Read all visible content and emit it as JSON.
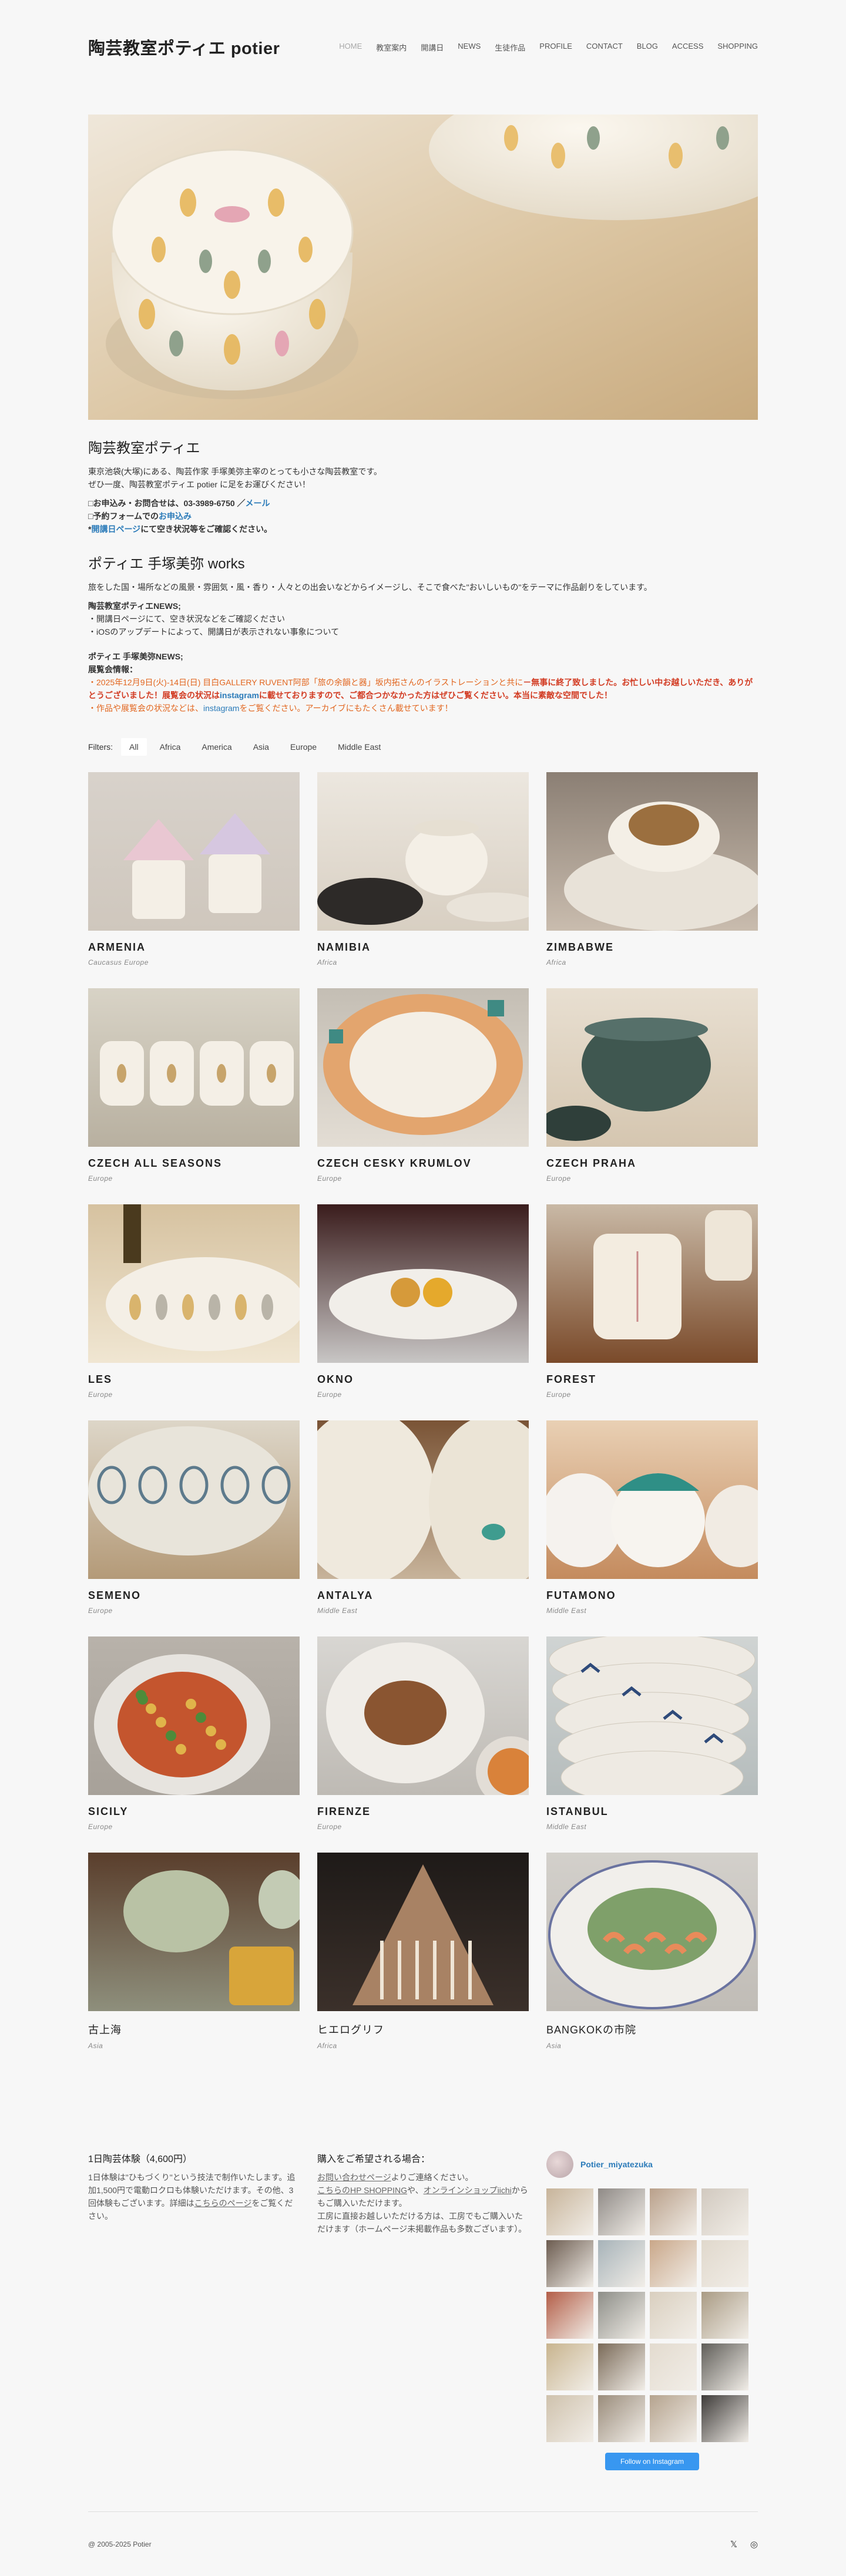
{
  "site": {
    "logo": "陶芸教室ポティエ potier"
  },
  "nav": [
    {
      "label": "HOME",
      "active": true
    },
    {
      "label": "教室案内"
    },
    {
      "label": "開講日"
    },
    {
      "label": "NEWS"
    },
    {
      "label": "生徒作品"
    },
    {
      "label": "PROFILE"
    },
    {
      "label": "CONTACT"
    },
    {
      "label": "BLOG"
    },
    {
      "label": "ACCESS"
    },
    {
      "label": "SHOPPING"
    }
  ],
  "intro": {
    "title": "陶芸教室ポティエ",
    "line1": "東京池袋(大塚)にある、陶芸作家 手塚美弥主宰のとっても小さな陶芸教室です。",
    "line2": "ぜひ一度、陶芸教室ポティエ potier に足をお運びください！",
    "contact_prefix": "□お申込み・お問合せは、",
    "contact_tel": "03-3989-6750",
    "contact_sep": " ／",
    "contact_mail": "メール",
    "form_prefix": "□予約フォームでの",
    "form_link": "お申込み",
    "calendar_prefix": "*",
    "calendar_link": "開講日ページ",
    "calendar_suffix": "にて空き状況等をご確認ください。",
    "works_title": "ポティエ 手塚美弥 works",
    "works_line": "旅をした国・場所などの風景・雰囲気・風・香り・人々との出会いなどからイメージし、そこで食べた\"おいしいもの\"をテーマに作品創りをしています。",
    "news_head": "陶芸教室ポティエNEWS;",
    "news_1": "・開講日ページにて、空き状況などをご確認ください",
    "news_2": "・iOSのアップデートによって、開講日が表示されない事象について",
    "works_news_head": "ポティエ 手塚美弥NEWS;",
    "exhibit_head": "展覧会情報：",
    "exhibit_a": "・2025年12月9日(火)-14日(日) 目白GALLERY RUVENT阿部「旅の余韻と器」坂内拓さんのイラストレーションと共に",
    "exhibit_b": "－無事に終了致しました。お忙しい中お越しいただき、ありがとうございました！展覧会の状況は",
    "exhibit_c": "instagram",
    "exhibit_d": "に載せておりますので、ご都合つかなかった方はぜひご覧ください。本当に素敵な空間でした！",
    "exhibit_e_a": "・作品や展覧会の状況などは、",
    "exhibit_e_b": "instagram",
    "exhibit_e_c": "をご覧ください。アーカイブにもたくさん載せています！"
  },
  "filters": {
    "label": "Filters:",
    "items": [
      {
        "label": "All",
        "active": true
      },
      {
        "label": "Africa"
      },
      {
        "label": "America"
      },
      {
        "label": "Asia"
      },
      {
        "label": "Europe"
      },
      {
        "label": "Middle East"
      }
    ]
  },
  "gallery": [
    {
      "title": "ARMENIA",
      "category": "Caucasus Europe",
      "art": "armenia"
    },
    {
      "title": "NAMIBIA",
      "category": "Africa",
      "art": "namibia"
    },
    {
      "title": "ZIMBABWE",
      "category": "Africa",
      "art": "zimbabwe"
    },
    {
      "title": "CZECH ALL SEASONS",
      "category": "Europe",
      "art": "czech1"
    },
    {
      "title": "CZECH CESKY KRUMLOV",
      "category": "Europe",
      "art": "czech2"
    },
    {
      "title": "CZECH PRAHA",
      "category": "Europe",
      "art": "czech3"
    },
    {
      "title": "LES",
      "category": "Europe",
      "art": "les"
    },
    {
      "title": "OKNO",
      "category": "Europe",
      "art": "okno"
    },
    {
      "title": "FOREST",
      "category": "Europe",
      "art": "forest"
    },
    {
      "title": "SEMENO",
      "category": "Europe",
      "art": "semeno"
    },
    {
      "title": "ANTALYA",
      "category": "Middle East",
      "art": "antalya"
    },
    {
      "title": "FUTAMONO",
      "category": "Middle East",
      "art": "futamono"
    },
    {
      "title": "SICILY",
      "category": "Europe",
      "art": "sicily"
    },
    {
      "title": "FIRENZE",
      "category": "Europe",
      "art": "firenze"
    },
    {
      "title": "ISTANBUL",
      "category": "Middle East",
      "art": "istanbul"
    },
    {
      "title": "古上海",
      "category": "Asia",
      "art": "shanghai",
      "jp": true
    },
    {
      "title": "ヒエログリフ",
      "category": "Africa",
      "art": "hiero",
      "jp": true
    },
    {
      "title": "BANGKOKの市院",
      "category": "Asia",
      "art": "bangkok",
      "jp": true
    }
  ],
  "widget1": {
    "title": "1日陶芸体験（4,600円）",
    "text_a": "1日体験は\"ひもづくり\"という技法で制作いたします。追加1,500円で電動ロクロも体験いただけます。その他、3回体験もございます。詳細は",
    "link": "こちらのページ",
    "text_b": "をご覧ください。"
  },
  "widget2": {
    "title": "購入をご希望される場合：",
    "link1": "お問い合わせページ",
    "text1": "よりご連絡ください。",
    "link2": "こちらのHP SHOPPING",
    "text2": "や、",
    "link3": "オンラインショップiichi",
    "text3": "からもご購入いただけます。",
    "text4": "工房に直接お越しいただける方は、工房でもご購入いただけます（ホームページ未掲載作品も多数ございます）。"
  },
  "widget3": {
    "username": "Potier_miyatezuka",
    "follow_label": "Follow on Instagram",
    "photo_colors": [
      "#c7b49a",
      "#8f8a86",
      "#b9a08a",
      "#d1c9bf",
      "#6c5c50",
      "#a7b3b9",
      "#c9a789",
      "#e0d8cc",
      "#b35e48",
      "#8d8e88",
      "#d9cfbf",
      "#a99b84",
      "#c8b48e",
      "#7a6a58",
      "#e3dbcf",
      "#5f5d58",
      "#cfc2ad",
      "#9a8c7b",
      "#b5a38e",
      "#3d3a38"
    ]
  },
  "footer": {
    "copyright": "@ 2005-2025 Potier",
    "twitter_icon": "𝕏",
    "instagram_icon": "◎"
  }
}
